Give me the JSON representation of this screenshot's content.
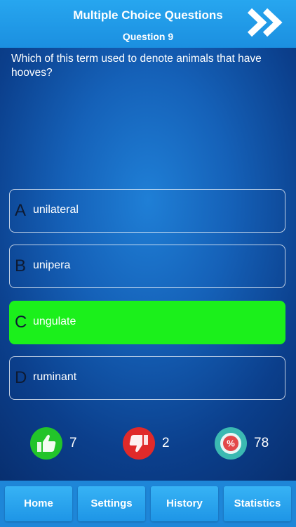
{
  "header": {
    "title": "Multiple Choice Questions",
    "question_number": "Question 9",
    "next_icon": "double-chevron-right-icon"
  },
  "question": {
    "text": "Which of this term used to denote animals that have hooves?"
  },
  "answers": [
    {
      "letter": "A",
      "text": "unilateral",
      "state": "default"
    },
    {
      "letter": "B",
      "text": "unipera",
      "state": "default"
    },
    {
      "letter": "C",
      "text": "ungulate",
      "state": "correct"
    },
    {
      "letter": "D",
      "text": "ruminant",
      "state": "default"
    }
  ],
  "stats": {
    "correct": {
      "icon": "thumbs-up-icon",
      "value": "7",
      "color": "#22c42a"
    },
    "wrong": {
      "icon": "thumbs-down-icon",
      "value": "2",
      "color": "#e02a2a"
    },
    "percent": {
      "icon": "percent-badge-icon",
      "value": "78",
      "color": "#39b9b1"
    }
  },
  "tabs": [
    {
      "label": "Home"
    },
    {
      "label": "Settings"
    },
    {
      "label": "History"
    },
    {
      "label": "Statistics"
    }
  ],
  "colors": {
    "header": "#22a0ec",
    "correct_answer": "#1bf01b",
    "tab": "#2aa6ef"
  }
}
